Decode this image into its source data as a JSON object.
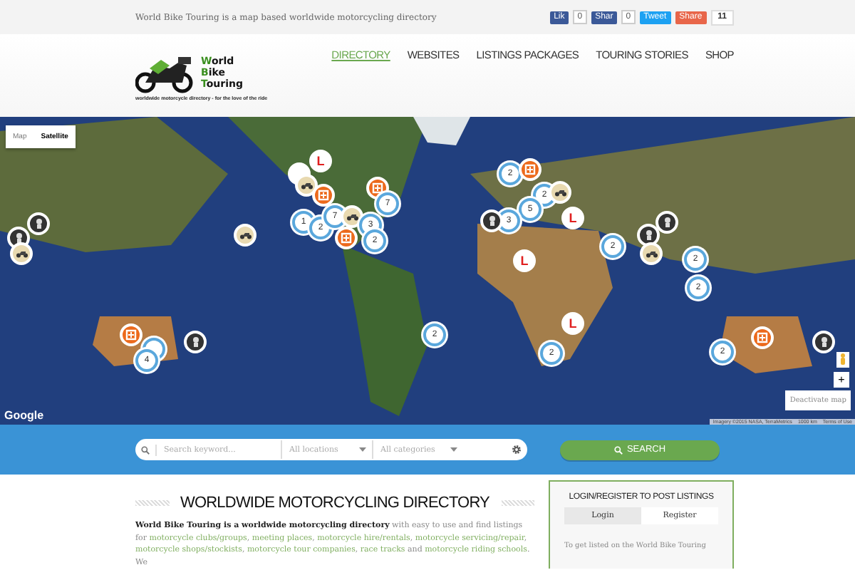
{
  "top_bar": {
    "tagline": "World Bike Touring is a map based worldwide motorcycling directory",
    "share": [
      {
        "kind": "facebook",
        "label": "Lik",
        "count": "0"
      },
      {
        "kind": "facebook",
        "label": "Shar",
        "count": "0"
      },
      {
        "kind": "twitter",
        "label": "Tweet"
      },
      {
        "kind": "share",
        "label": "Share"
      },
      {
        "kind": "total",
        "label": "11"
      }
    ]
  },
  "logo": {
    "words": [
      "World",
      "Bike",
      "Touring"
    ],
    "tagline": "worldwide motorcycle directory - for the love of the ride"
  },
  "nav": [
    {
      "label": "DIRECTORY",
      "selected": true
    },
    {
      "label": "WEBSITES",
      "selected": false
    },
    {
      "label": "LISTINGS PACKAGES",
      "selected": false
    },
    {
      "label": "TOURING STORIES",
      "selected": false
    },
    {
      "label": "SHOP",
      "selected": false
    }
  ],
  "map": {
    "types": [
      {
        "label": "Map",
        "selected": false
      },
      {
        "label": "Satellite",
        "selected": true
      }
    ],
    "markers": [
      {
        "kind": "learner",
        "label": "L"
      },
      {
        "kind": "learner"
      },
      {
        "kind": "bike"
      },
      {
        "kind": "orange"
      },
      {
        "kind": "orange"
      },
      {
        "kind": "cluster",
        "label": "7"
      },
      {
        "kind": "cluster",
        "label": "1"
      },
      {
        "kind": "cluster",
        "label": "2"
      },
      {
        "kind": "cluster",
        "label": "7"
      },
      {
        "kind": "bike"
      },
      {
        "kind": "cluster",
        "label": "3"
      },
      {
        "kind": "orange"
      },
      {
        "kind": "cluster",
        "label": "2"
      },
      {
        "kind": "bike"
      },
      {
        "kind": "dark"
      },
      {
        "kind": "dark"
      },
      {
        "kind": "bike"
      },
      {
        "kind": "orange"
      },
      {
        "kind": "cluster"
      },
      {
        "kind": "cluster",
        "label": "4"
      },
      {
        "kind": "dark"
      },
      {
        "kind": "cluster",
        "label": "2"
      },
      {
        "kind": "orange"
      },
      {
        "kind": "cluster",
        "label": "2"
      },
      {
        "kind": "bike"
      },
      {
        "kind": "cluster",
        "label": "5"
      },
      {
        "kind": "cluster",
        "label": "3"
      },
      {
        "kind": "dark"
      },
      {
        "kind": "learner",
        "label": "L"
      },
      {
        "kind": "learner",
        "label": "L"
      },
      {
        "kind": "cluster",
        "label": "2"
      },
      {
        "kind": "dark"
      },
      {
        "kind": "dark"
      },
      {
        "kind": "bike"
      },
      {
        "kind": "cluster",
        "label": "2"
      },
      {
        "kind": "cluster",
        "label": "2"
      },
      {
        "kind": "learner",
        "label": "L"
      },
      {
        "kind": "cluster",
        "label": "2"
      },
      {
        "kind": "cluster",
        "label": "2"
      },
      {
        "kind": "cluster",
        "label": "2"
      },
      {
        "kind": "orange"
      },
      {
        "kind": "dark"
      }
    ],
    "google": "Google",
    "attribution": "Imagery ©2015 NASA, TerraMetrics",
    "scale": "1000 km",
    "terms": "Terms of Use",
    "zoom_in": "+",
    "deactivate": "Deactivate map"
  },
  "search": {
    "placeholder": "Search keyword...",
    "location": "All locations",
    "category": "All categories",
    "button": "SEARCH"
  },
  "content": {
    "heading": "WORLDWIDE MOTORCYCLING DIRECTORY",
    "paragraph": [
      {
        "kind": "bold",
        "text": "World Bike Touring is a worldwide motorcycling directory"
      },
      {
        "kind": "text",
        "text": " with easy to use and find listings for "
      },
      {
        "kind": "link",
        "text": "motorcycle clubs/groups"
      },
      {
        "kind": "text",
        "text": ", "
      },
      {
        "kind": "link",
        "text": "meeting places"
      },
      {
        "kind": "text",
        "text": ", "
      },
      {
        "kind": "link",
        "text": "motorcycle hire/rentals"
      },
      {
        "kind": "text",
        "text": ", "
      },
      {
        "kind": "link",
        "text": "motorcycle servicing/repair"
      },
      {
        "kind": "text",
        "text": ", "
      },
      {
        "kind": "link",
        "text": "motorcycle shops/stockists"
      },
      {
        "kind": "text",
        "text": ", "
      },
      {
        "kind": "link",
        "text": "motorcycle tour companies"
      },
      {
        "kind": "text",
        "text": ", "
      },
      {
        "kind": "link",
        "text": "race tracks"
      },
      {
        "kind": "text",
        "text": " and "
      },
      {
        "kind": "link",
        "text": "motorcycle riding schools"
      },
      {
        "kind": "text",
        "text": ". We"
      }
    ]
  },
  "sidebar": {
    "heading": "LOGIN/REGISTER TO POST LISTINGS",
    "tabs": [
      {
        "label": "Login",
        "selected": false
      },
      {
        "label": "Register",
        "selected": true
      }
    ],
    "text": "To get listed on the World Bike Touring"
  }
}
